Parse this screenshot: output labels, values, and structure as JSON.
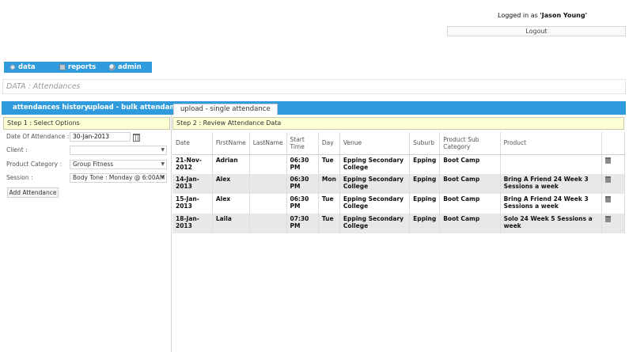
{
  "header": {
    "logged_in_prefix": "Logged in as ",
    "user": "'Jason Young'",
    "logout_label": "Logout"
  },
  "topnav": [
    {
      "label": "data",
      "icon": "database-icon"
    },
    {
      "label": "reports",
      "icon": "reports-icon"
    },
    {
      "label": "admin",
      "icon": "admin-icon"
    }
  ],
  "page_title": "DATA : Attendances",
  "tabs": [
    {
      "label": "attendances history"
    },
    {
      "label": "upload - bulk attendance"
    },
    {
      "label": "upload - single attendance",
      "active": true
    }
  ],
  "step1": {
    "title": "Step 1 : Select Options",
    "date_label": "Date Of Attendance :",
    "date_value": "30-Jan-2013",
    "client_label": "Client :",
    "client_value": "",
    "category_label": "Product Category :",
    "category_value": "Group Fitness",
    "session_label": "Session :",
    "session_value": "Body Tone : Monday @  6:00AM [",
    "add_button": "Add Attendance"
  },
  "step2": {
    "title": "Step 2 : Review Attendance Data",
    "columns": [
      "Date",
      "FirstName",
      "LastName",
      "Start Time",
      "Day",
      "Venue",
      "Suburb",
      "Product Sub Category",
      "Product",
      ""
    ],
    "rows": [
      {
        "date": "21-Nov-2012",
        "first": "Adrian",
        "last": "",
        "start": "06:30 PM",
        "day": "Tue",
        "venue": "Epping Secondary College",
        "suburb": "Epping",
        "subcat": "Boot Camp",
        "product": ""
      },
      {
        "date": "14-Jan-2013",
        "first": "Alex",
        "last": "",
        "start": "06:30 PM",
        "day": "Mon",
        "venue": "Epping Secondary College",
        "suburb": "Epping",
        "subcat": "Boot Camp",
        "product": "Bring A Friend 24 Week 3 Sessions a week"
      },
      {
        "date": "15-Jan-2013",
        "first": "Alex",
        "last": "",
        "start": "06:30 PM",
        "day": "Tue",
        "venue": "Epping Secondary College",
        "suburb": "Epping",
        "subcat": "Boot Camp",
        "product": "Bring A Friend 24 Week 3 Sessions a week"
      },
      {
        "date": "18-Jan-2013",
        "first": "Laila",
        "last": "",
        "start": "07:30 PM",
        "day": "Tue",
        "venue": "Epping Secondary College",
        "suburb": "Epping",
        "subcat": "Boot Camp",
        "product": "Solo 24 Week 5 Sessions a week"
      }
    ]
  },
  "colors": {
    "accent": "#2f9bdc",
    "step_header_bg": "#ffffd6",
    "row_alt": "#e8e8e8"
  }
}
